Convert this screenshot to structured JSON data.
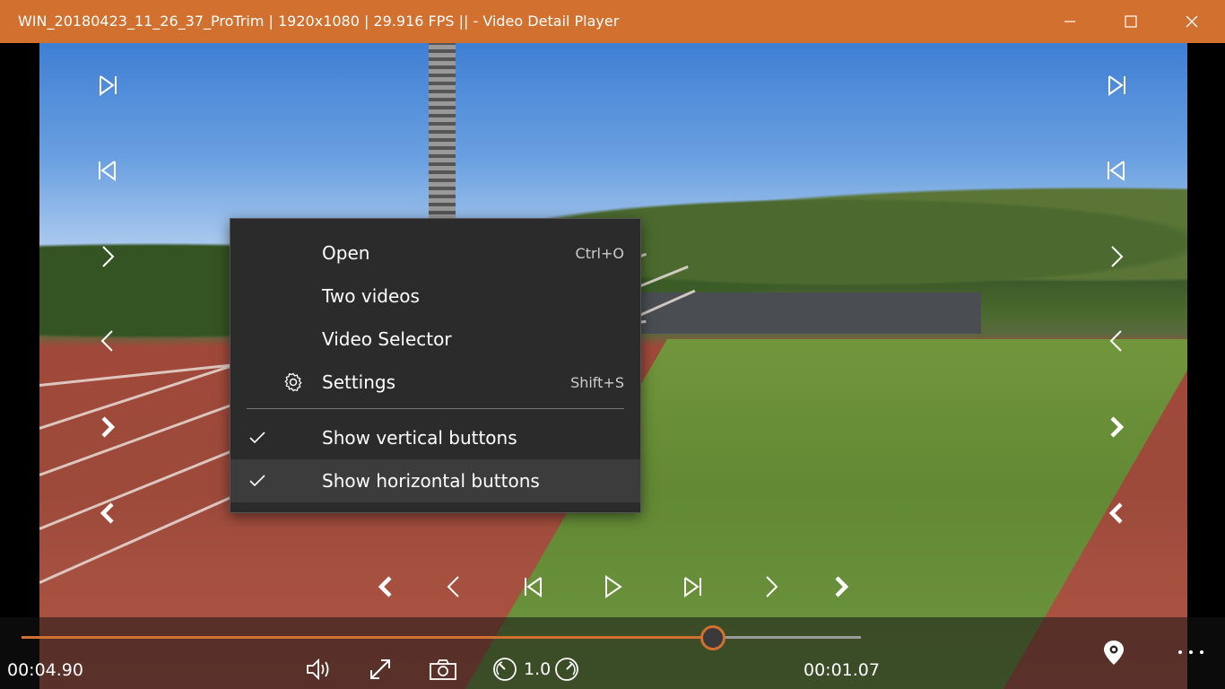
{
  "window": {
    "title": "WIN_20180423_11_26_37_ProTrim | 1920x1080 | 29.916 FPS ||  - Video Detail Player",
    "controls": [
      "minimize-icon",
      "maximize-icon",
      "close-icon"
    ]
  },
  "side_buttons": {
    "left": [
      "next-frame-icon",
      "previous-frame-icon",
      "step-forward-icon",
      "step-back-icon",
      "jump-forward-icon",
      "jump-back-icon"
    ],
    "right": [
      "next-frame-icon",
      "previous-frame-icon",
      "step-forward-icon",
      "step-back-icon",
      "jump-forward-icon",
      "jump-back-icon"
    ]
  },
  "context_menu": {
    "items": [
      {
        "label": "Open",
        "shortcut": "Ctrl+O",
        "icon": "",
        "checked": false
      },
      {
        "label": "Two videos",
        "shortcut": "",
        "icon": "",
        "checked": false
      },
      {
        "label": "Video Selector",
        "shortcut": "",
        "icon": "",
        "checked": false
      },
      {
        "label": "Settings",
        "shortcut": "Shift+S",
        "icon": "gear-icon",
        "checked": false
      },
      {
        "label": "Show vertical buttons",
        "shortcut": "",
        "icon": "",
        "checked": true
      },
      {
        "label": "Show horizontal buttons",
        "shortcut": "",
        "icon": "",
        "checked": true,
        "highlighted": true
      }
    ]
  },
  "playback": {
    "elapsed": "00:04.90",
    "remaining": "00:01.07",
    "speed": "1.0",
    "progress_fraction": 0.824,
    "accent_color": "#d2702f"
  },
  "horizontal_buttons": [
    "jump-back-icon",
    "step-back-icon",
    "previous-frame-icon",
    "play-icon",
    "next-frame-icon",
    "step-forward-icon",
    "jump-forward-icon"
  ],
  "toolbar": [
    "volume-icon",
    "fullscreen-icon",
    "camera-icon",
    "slower-icon",
    "faster-icon",
    "location-pin-icon",
    "more-icon"
  ]
}
